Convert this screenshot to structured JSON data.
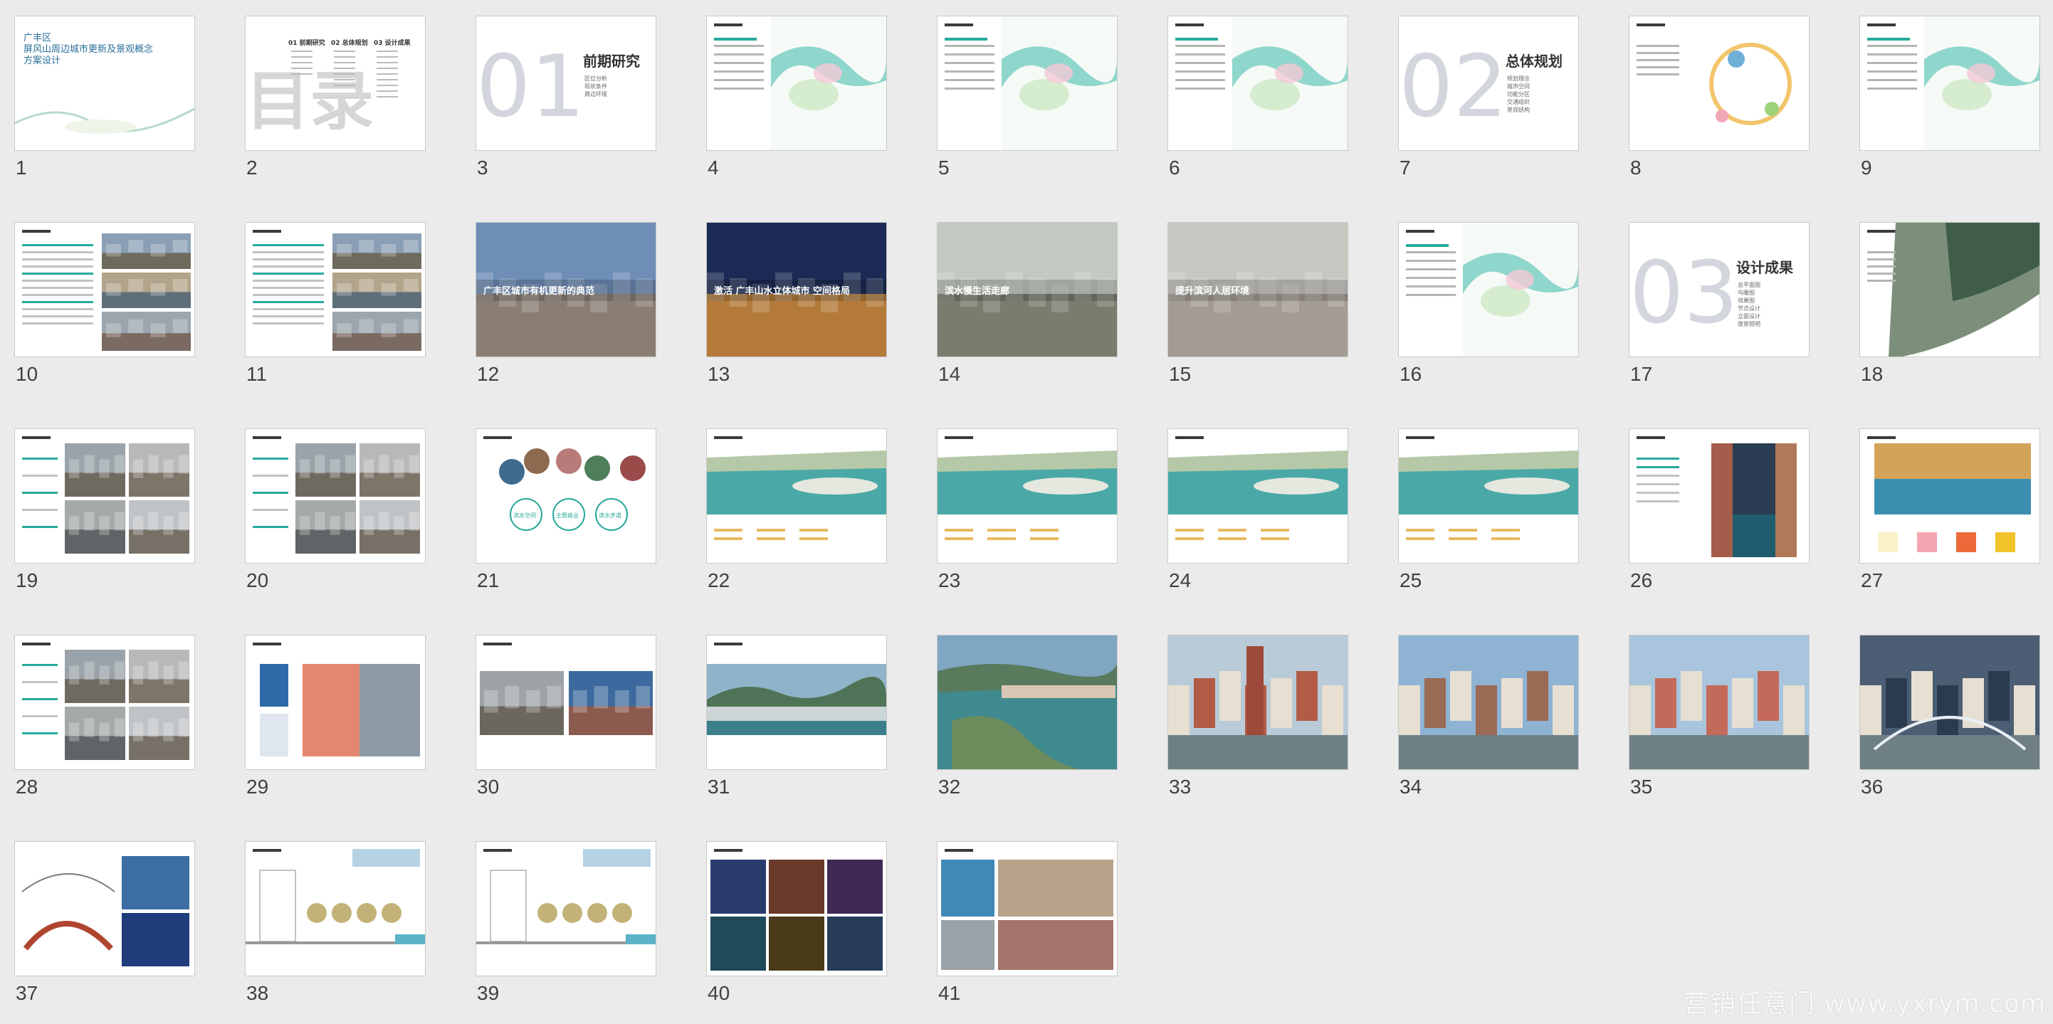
{
  "watermark": "营销任意门 www.yxrym.com",
  "slides": [
    {
      "n": "1",
      "kind": "cover",
      "lines": [
        "广丰区",
        "屏风山周边城市更新及景观概念",
        "方案设计"
      ]
    },
    {
      "n": "2",
      "kind": "toc",
      "glyph": "目录",
      "lines": [
        "01 前期研究",
        "02 总体规划",
        "03 设计成果"
      ]
    },
    {
      "n": "3",
      "kind": "section",
      "big": "01",
      "title": "前期研究",
      "lines": [
        "区位分析",
        "现状条件",
        "周边环境"
      ]
    },
    {
      "n": "4",
      "kind": "map"
    },
    {
      "n": "5",
      "kind": "map"
    },
    {
      "n": "6",
      "kind": "map"
    },
    {
      "n": "7",
      "kind": "section",
      "big": "02",
      "title": "总体规划",
      "lines": [
        "规划理念",
        "城市空间",
        "功能分区",
        "交通组织",
        "景观结构"
      ]
    },
    {
      "n": "8",
      "kind": "diagram"
    },
    {
      "n": "9",
      "kind": "map"
    },
    {
      "n": "10",
      "kind": "textphoto"
    },
    {
      "n": "11",
      "kind": "textphoto"
    },
    {
      "n": "12",
      "kind": "fullphoto",
      "title": "广丰区城市有机更新的典范",
      "tone": "dusk"
    },
    {
      "n": "13",
      "kind": "fullphoto",
      "title": "激活 广丰山水立体城市 空间格局",
      "tone": "night"
    },
    {
      "n": "14",
      "kind": "fullphoto",
      "title": "滨水慢生活走廊",
      "tone": "street"
    },
    {
      "n": "15",
      "kind": "fullphoto",
      "title": "提升滨河人居环境",
      "tone": "plaza"
    },
    {
      "n": "16",
      "kind": "map"
    },
    {
      "n": "17",
      "kind": "section",
      "big": "03",
      "title": "设计成果",
      "lines": [
        "总平面图",
        "鸟瞰图",
        "效果图",
        "节点设计",
        "立面设计",
        "夜景照明"
      ]
    },
    {
      "n": "18",
      "kind": "aerialband"
    },
    {
      "n": "19",
      "kind": "photogrid"
    },
    {
      "n": "20",
      "kind": "photogrid"
    },
    {
      "n": "21",
      "kind": "circles",
      "labels": [
        "滨水空间",
        "主题商业",
        "滨水步道"
      ]
    },
    {
      "n": "22",
      "kind": "plan"
    },
    {
      "n": "23",
      "kind": "plan"
    },
    {
      "n": "24",
      "kind": "plan"
    },
    {
      "n": "25",
      "kind": "plan"
    },
    {
      "n": "26",
      "kind": "canal"
    },
    {
      "n": "27",
      "kind": "palette"
    },
    {
      "n": "28",
      "kind": "photogrid"
    },
    {
      "n": "29",
      "kind": "facade"
    },
    {
      "n": "30",
      "kind": "twophoto"
    },
    {
      "n": "31",
      "kind": "panorama"
    },
    {
      "n": "32",
      "kind": "aerial"
    },
    {
      "n": "33",
      "kind": "render",
      "tone": "tower"
    },
    {
      "n": "34",
      "kind": "render",
      "tone": "town"
    },
    {
      "n": "35",
      "kind": "render",
      "tone": "colorful"
    },
    {
      "n": "36",
      "kind": "render",
      "tone": "bridge"
    },
    {
      "n": "37",
      "kind": "arch"
    },
    {
      "n": "38",
      "kind": "section2"
    },
    {
      "n": "39",
      "kind": "section2"
    },
    {
      "n": "40",
      "kind": "nightgrid"
    },
    {
      "n": "41",
      "kind": "pavement"
    }
  ]
}
